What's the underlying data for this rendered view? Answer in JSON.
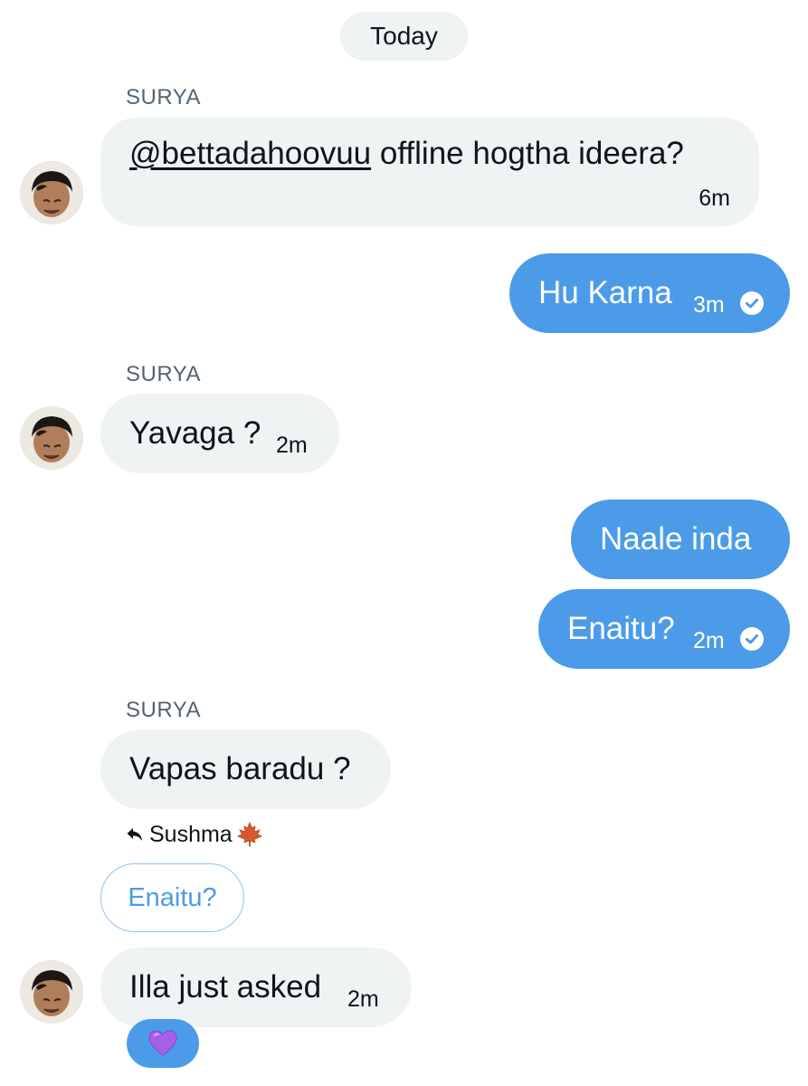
{
  "date_divider": "Today",
  "messages": [
    {
      "sender": "SURYA",
      "direction": "incoming",
      "text_parts": [
        "@bettadahoovuu",
        " offline hogtha ideera?"
      ],
      "time": "6m"
    },
    {
      "direction": "outgoing",
      "text": "Hu Karna",
      "time": "3m",
      "status_icon": "check-circle-icon"
    },
    {
      "sender": "SURYA",
      "direction": "incoming",
      "text": "Yavaga ?",
      "time": "2m"
    },
    {
      "direction": "outgoing",
      "text": "Naale inda"
    },
    {
      "direction": "outgoing",
      "text": "Enaitu?",
      "time": "2m",
      "status_icon": "check-circle-icon"
    },
    {
      "sender": "SURYA",
      "direction": "incoming",
      "text": "Vapas baradu ?"
    },
    {
      "direction": "incoming",
      "reply_to": {
        "name": "Sushma",
        "name_emoji": "🍁",
        "quoted_text": "Enaitu?"
      },
      "text": "Illa just asked",
      "time": "2m",
      "reaction": "💜"
    }
  ],
  "colors": {
    "outgoing_bubble": "#4b9be8",
    "incoming_bubble": "#eff3f4",
    "sender_label": "#536471",
    "reaction_pill": "#4b9be8"
  }
}
